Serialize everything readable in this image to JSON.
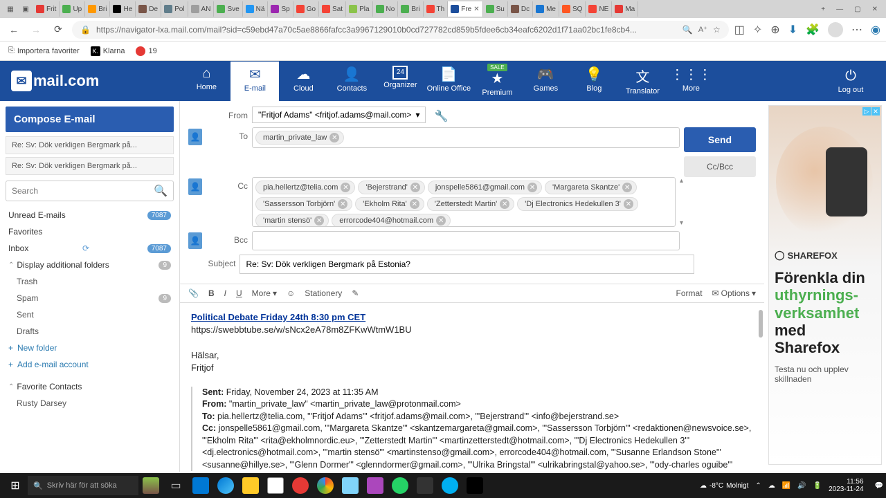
{
  "browser": {
    "tabs": [
      {
        "label": "Frit",
        "color": "#e53935"
      },
      {
        "label": "Up",
        "color": "#4caf50"
      },
      {
        "label": "Bri",
        "color": "#ff9800"
      },
      {
        "label": "He",
        "color": "#000"
      },
      {
        "label": "De",
        "color": "#795548"
      },
      {
        "label": "Pol",
        "color": "#607d8b"
      },
      {
        "label": "AN",
        "color": "#9e9e9e"
      },
      {
        "label": "Sve",
        "color": "#4caf50"
      },
      {
        "label": "Nä",
        "color": "#2196f3"
      },
      {
        "label": "Sp",
        "color": "#9c27b0"
      },
      {
        "label": "Go",
        "color": "#f44336"
      },
      {
        "label": "Sat",
        "color": "#f44336"
      },
      {
        "label": "Pla",
        "color": "#8bc34a"
      },
      {
        "label": "No",
        "color": "#4caf50"
      },
      {
        "label": "Bri",
        "color": "#4caf50"
      },
      {
        "label": "Th",
        "color": "#f44336"
      },
      {
        "label": "Fre",
        "color": "#1c4e9c",
        "active": true
      },
      {
        "label": "Su",
        "color": "#4caf50"
      },
      {
        "label": "Dc",
        "color": "#795548"
      },
      {
        "label": "Me",
        "color": "#1976d2"
      },
      {
        "label": "SQ",
        "color": "#ff5722"
      },
      {
        "label": "NE",
        "color": "#f44336"
      },
      {
        "label": "Ma",
        "color": "#e53935"
      }
    ],
    "url": "https://navigator-lxa.mail.com/mail?sid=c59ebd47a70c5ae8866fafcc3a9967129010b0cd727782cd859b5fdee6cb34eafc6202d1f71aa02bc1fe8cb4...",
    "bookmarks": {
      "import": "Importera favoriter",
      "klarna": "Klarna",
      "nineteen": "19"
    }
  },
  "mailnav": {
    "home": "Home",
    "email": "E-mail",
    "cloud": "Cloud",
    "contacts": "Contacts",
    "organizer": "Organizer",
    "organizer_day": "24",
    "office": "Online Office",
    "premium": "Premium",
    "sale": "SALE",
    "games": "Games",
    "blog": "Blog",
    "translator": "Translator",
    "more": "More",
    "logout": "Log out"
  },
  "sidebar": {
    "compose": "Compose E-mail",
    "drafts": [
      "Re: Sv: Dök verkligen Bergmark på...",
      "Re: Sv: Dök verkligen Bergmark på..."
    ],
    "search_placeholder": "Search",
    "folders": {
      "unread": "Unread E-mails",
      "unread_count": "7087",
      "favorites": "Favorites",
      "inbox": "Inbox",
      "inbox_count": "7087",
      "additional": "Display additional folders",
      "additional_count": "9",
      "trash": "Trash",
      "spam": "Spam",
      "spam_count": "9",
      "sent": "Sent",
      "drafts_f": "Drafts"
    },
    "new_folder": "New folder",
    "add_account": "Add e-mail account",
    "fav_contacts": "Favorite Contacts",
    "contact1": "Rusty Darsey"
  },
  "compose": {
    "labels": {
      "from": "From",
      "to": "To",
      "cc": "Cc",
      "bcc": "Bcc",
      "subject": "Subject"
    },
    "from": "\"Fritjof Adams\" <fritjof.adams@mail.com>",
    "to": [
      "martin_private_law"
    ],
    "cc": [
      "pia.hellertz@telia.com",
      "'Bejerstrand'",
      "jonspelle5861@gmail.com",
      "'Margareta Skantze'",
      "'Sassersson Torbjörn'",
      "'Ekholm Rita'",
      "'Zetterstedt Martin'",
      "'Dj Electronics Hedekullen 3'",
      "'martin stensö'",
      "errorcode404@hotmail.com"
    ],
    "subject": "Re: Sv: Dök verkligen Bergmark på Estonia?",
    "send": "Send",
    "ccbcc": "Cc/Bcc"
  },
  "toolbar": {
    "more": "More",
    "stationery": "Stationery",
    "format": "Format",
    "options": "Options"
  },
  "body": {
    "headline": "Political Debate Friday 24th 8:30 pm CET",
    "link": "https://swebbtube.se/w/sNcx2eA78m8ZFKwWtmW1BU",
    "greet": "Hälsar,",
    "sign": "Fritjof",
    "q_sent_l": "Sent:",
    "q_sent": " Friday, November 24, 2023 at 11:35 AM",
    "q_from_l": "From:",
    "q_from": " \"martin_private_law\" <martin_private_law@protonmail.com>",
    "q_to_l": "To:",
    "q_to": " pia.hellertz@telia.com, \"'Fritjof Adams'\" <fritjof.adams@mail.com>, \"'Bejerstrand'\" <info@bejerstrand.se>",
    "q_cc_l": "Cc:",
    "q_cc": " jonspelle5861@gmail.com, \"'Margareta Skantze'\" <skantzemargareta@gmail.com>, \"'Sassersson Torbjörn'\" <redaktionen@newsvoice.se>, \"'Ekholm Rita'\" <rita@ekholmnordic.eu>, \"'Zetterstedt Martin'\" <martinzetterstedt@hotmail.com>, \"'Dj Electronics Hedekullen 3'\" <dj.electronics@hotmail.com>, \"'martin stensö'\" <martinstenso@gmail.com>, errorcode404@hotmail.com, \"'Susanne Erlandson Stone'\" <susanne@hillye.se>, \"'Glenn Dormer'\" <glenndormer@gmail.com>, \"'Ulrika Bringstal'\" <ulrikabringstal@yahoo.se>, \"'ody-charles oguibe'\""
  },
  "ad": {
    "brand": "SHAREFOX",
    "h1": "Förenkla din",
    "h2": "uthyrnings-",
    "h3": "verksamhet",
    "h4": "med",
    "h5": "Sharefox",
    "sub": "Testa nu och upplev skillnaden"
  },
  "taskbar": {
    "search": "Skriv här för att söka",
    "weather_temp": "-8°C",
    "weather_cond": "Molnigt",
    "time": "11:56",
    "date": "2023-11-24"
  }
}
